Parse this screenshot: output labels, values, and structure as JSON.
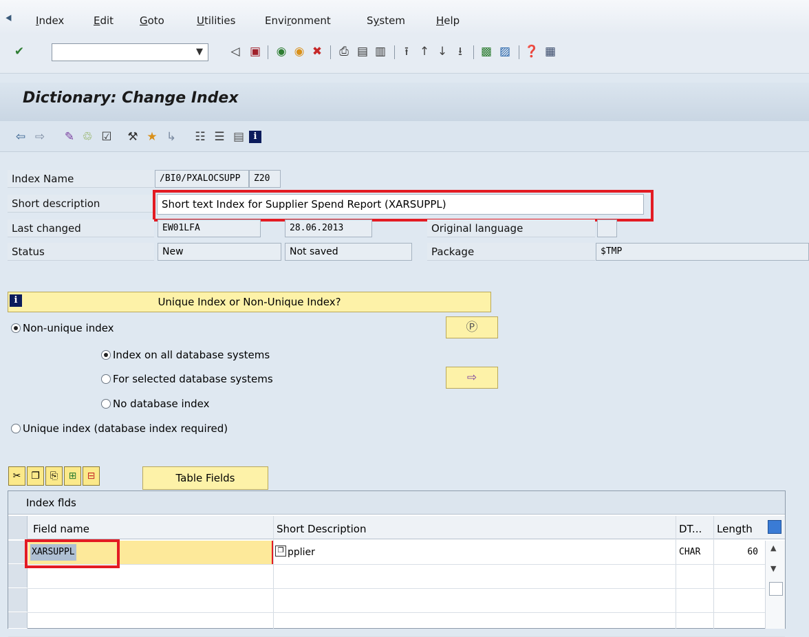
{
  "menu": {
    "items": [
      {
        "label": "Index",
        "u": "I",
        "rest": "ndex"
      },
      {
        "label": "Edit",
        "u": "E",
        "rest": "dit"
      },
      {
        "label": "Goto",
        "u": "G",
        "rest": "oto"
      },
      {
        "label": "Utilities",
        "u": "U",
        "rest": "tilities"
      },
      {
        "label": "Environment",
        "pre": "Envi",
        "u": "r",
        "rest": "onment"
      },
      {
        "label": "System",
        "pre": "S",
        "u": "y",
        "rest": "stem"
      },
      {
        "label": "Help",
        "u": "H",
        "rest": "elp"
      }
    ]
  },
  "command_field": {
    "value": ""
  },
  "title": "Dictionary: Change Index",
  "form": {
    "index_name": {
      "label": "Index Name",
      "table": "/BI0/PXALOCSUPP",
      "id": "Z20"
    },
    "short_description": {
      "label": "Short description",
      "value": "Short text Index for Supplier Spend Report (XARSUPPL)"
    },
    "last_changed": {
      "label": "Last changed",
      "user": "EW01LFA",
      "date": "28.06.2013"
    },
    "original_language": {
      "label": "Original language",
      "value": ""
    },
    "status": {
      "label": "Status",
      "value": "New",
      "save_state": "Not saved"
    },
    "package": {
      "label": "Package",
      "value": "$TMP"
    }
  },
  "info_bar": {
    "text": "Unique Index or Non-Unique Index?"
  },
  "options": {
    "non_unique": "Non-unique index",
    "all_db": "Index on all database systems",
    "selected_db": "For selected database systems",
    "no_db": "No database index",
    "unique": "Unique index (database index required)"
  },
  "table_fields_button": "Table Fields",
  "grid": {
    "title": "Index flds",
    "columns": [
      "Field name",
      "Short Description",
      "DT...",
      "Length"
    ],
    "rows": [
      {
        "field": "XARSUPPL",
        "desc": "pplier",
        "dt": "CHAR",
        "length": "60"
      }
    ]
  },
  "colors": {
    "highlight_red": "#e31b23",
    "button_yellow": "#fdf2a8",
    "info_icon": "#0c1c5c"
  }
}
